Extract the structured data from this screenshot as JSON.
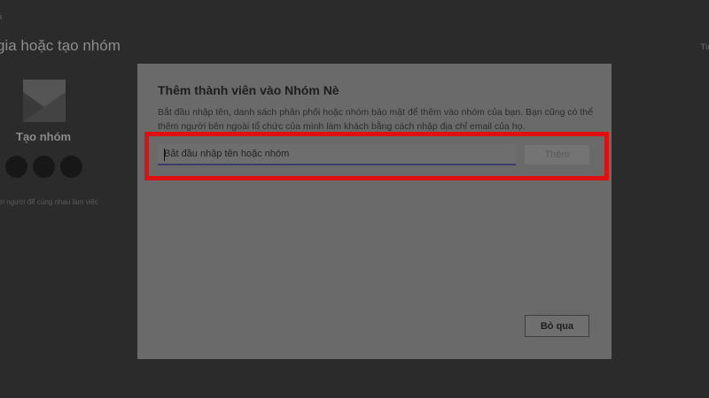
{
  "background": {
    "tiny_top_left": "i",
    "title": "gia hoặc tạo nhóm",
    "right_text": "Tìm",
    "team_card": {
      "label": "Tạo nhóm",
      "icon": "team-card-icon"
    },
    "description": "ời người để cùng nhau làm việc"
  },
  "dialog": {
    "title": "Thêm thành viên vào Nhóm Nè",
    "description": "Bắt đầu nhập tên, danh sách phân phối hoặc nhóm bảo mật để thêm vào nhóm của bạn. Bạn cũng có thể thêm người bên ngoài tổ chức của mình làm khách bằng cách nhập địa chỉ email của họ.",
    "search": {
      "placeholder": "Bắt đầu nhập tên hoặc nhóm",
      "value": ""
    },
    "add_label": "Thêm",
    "skip_label": "Bỏ qua"
  },
  "colors": {
    "highlight": "#e01010",
    "overlay": "#2b2b2b",
    "dialog_bg": "#6a6a6a"
  }
}
